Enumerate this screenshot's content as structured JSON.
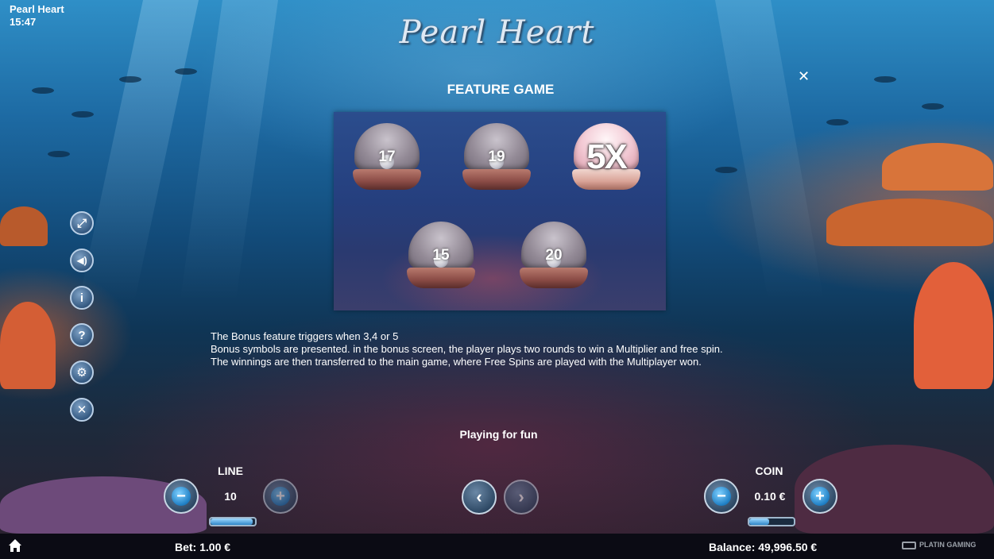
{
  "header": {
    "app_name": "Pearl Heart",
    "time": "15:47",
    "logo_text": "Pearl Heart"
  },
  "dialog": {
    "title": "FEATURE GAME",
    "close_icon": "close-icon",
    "shells": [
      {
        "value": "17",
        "style": "grey"
      },
      {
        "value": "19",
        "style": "grey"
      },
      {
        "value": "5X",
        "style": "pink"
      },
      {
        "value": "15",
        "style": "grey"
      },
      {
        "value": "20",
        "style": "grey"
      }
    ],
    "description": [
      "The Bonus feature triggers when 3,4 or 5",
      "Bonus symbols are presented. in the bonus screen, the player plays two rounds to win a Multiplier and free spin.",
      "The winnings are then transferred to the main game, where Free Spins are played with the Multiplayer won."
    ]
  },
  "side_menu": [
    {
      "icon": "fullscreen-icon",
      "glyph": "⤢"
    },
    {
      "icon": "sound-icon",
      "glyph": "🔊"
    },
    {
      "icon": "info-icon",
      "glyph": "i"
    },
    {
      "icon": "help-icon",
      "glyph": "?"
    },
    {
      "icon": "settings-icon",
      "glyph": "⚙"
    },
    {
      "icon": "exit-icon",
      "glyph": "✕"
    }
  ],
  "status": {
    "playing_text": "Playing for fun"
  },
  "controls": {
    "line": {
      "label": "LINE",
      "value": "10",
      "slider_fraction": 0.95
    },
    "coin": {
      "label": "COIN",
      "value": "0.10 €",
      "slider_fraction": 0.45
    },
    "minus_glyph": "−",
    "plus_glyph": "+",
    "prev_glyph": "‹",
    "next_glyph": "›"
  },
  "footer": {
    "bet": "Bet: 1.00 €",
    "balance": "Balance: 49,996.50 €",
    "brand": "PLATIN GAMING",
    "home_icon": "home-icon"
  },
  "colors": {
    "accent_blue": "#1f7fc4",
    "bar_bg": "#0b0b14"
  }
}
